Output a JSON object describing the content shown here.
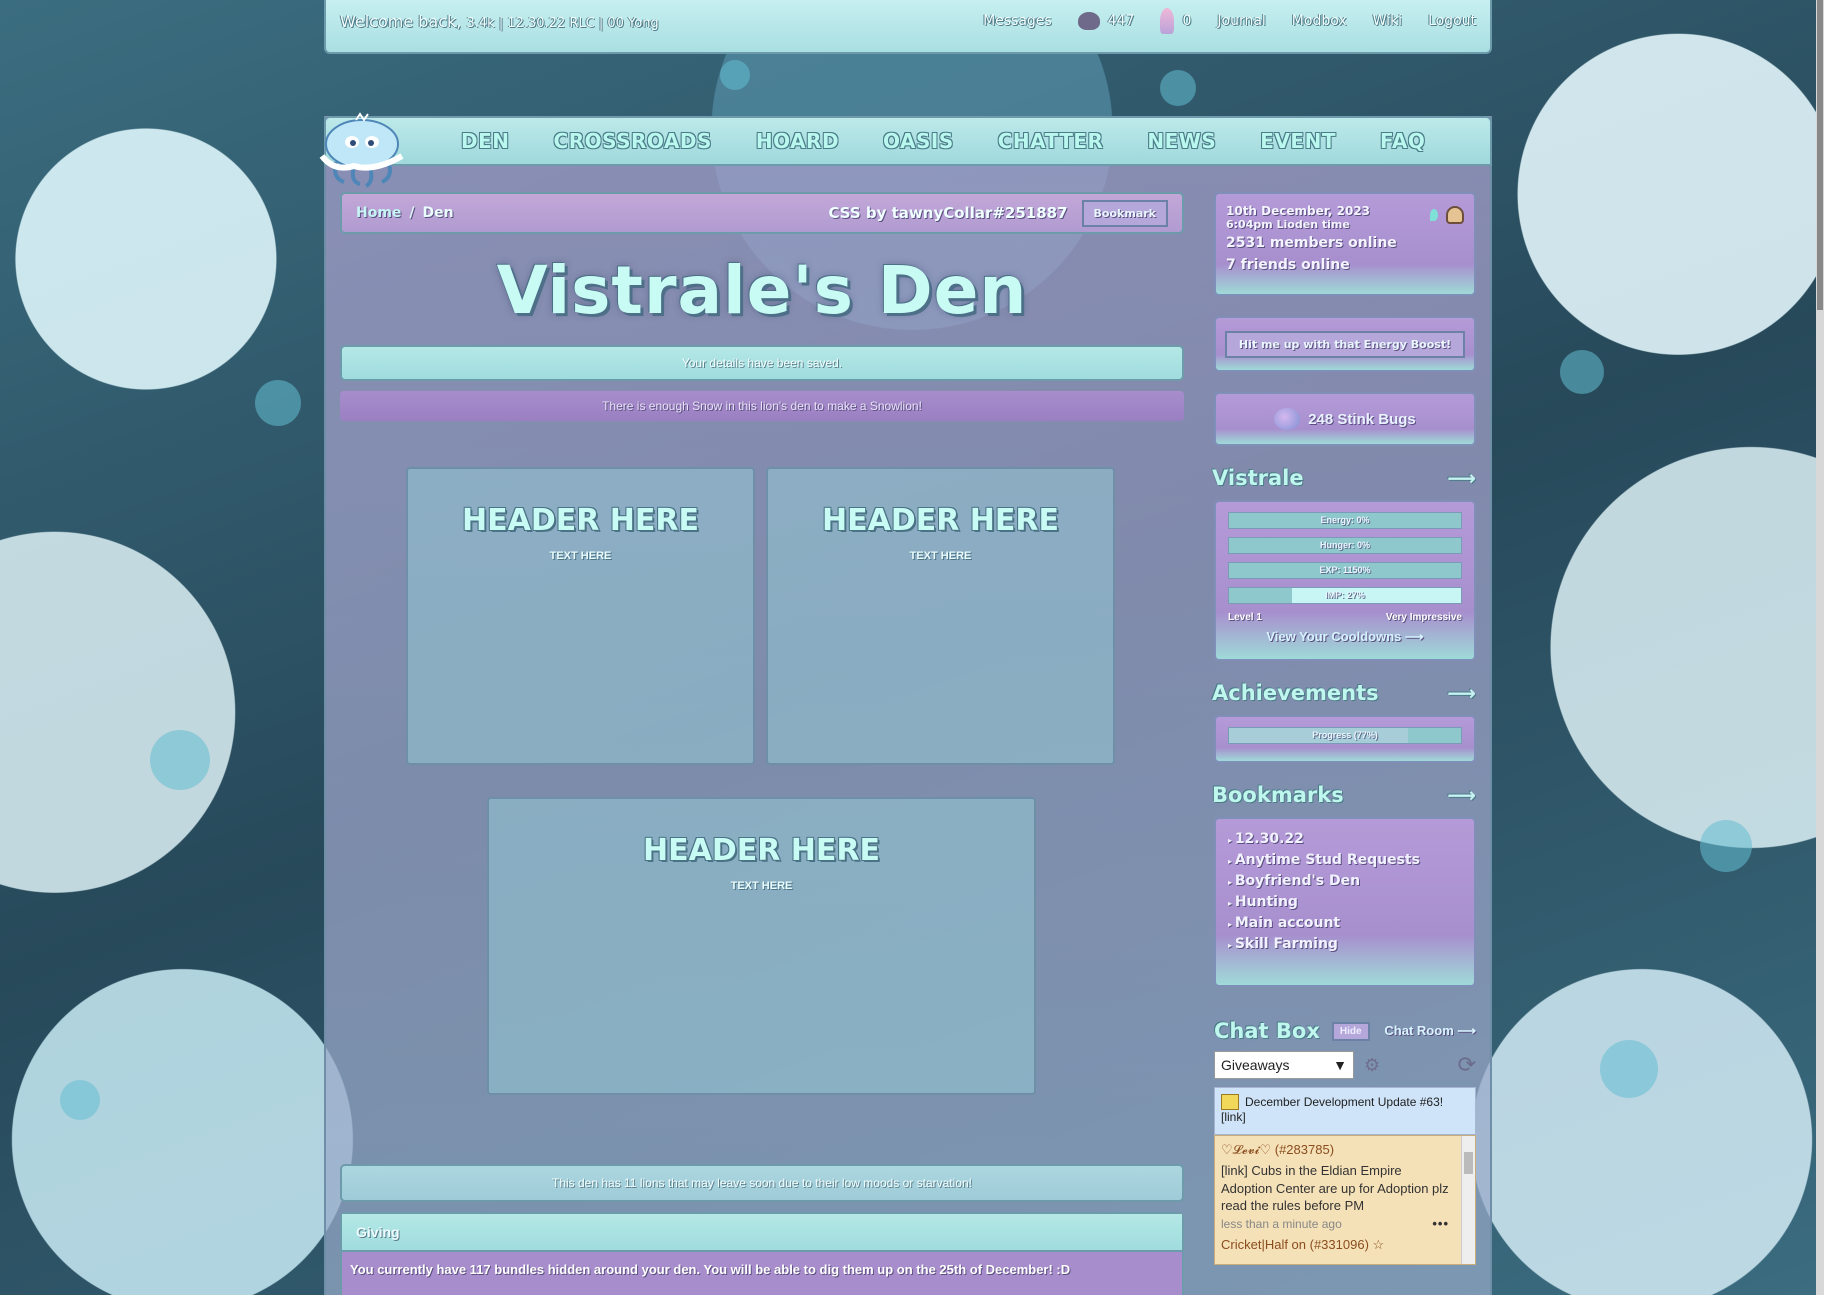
{
  "topbar": {
    "welcome": "Welcome back,",
    "welcome_sub": "3.4k | 12.30.22 RLC | 00 Yong",
    "links": [
      "Messages",
      "Journal",
      "Modbox",
      "Wiki",
      "Logout"
    ],
    "currency1": "447",
    "currency2": "0"
  },
  "nav": [
    "DEN",
    "CROSSROADS",
    "HOARD",
    "OASIS",
    "CHATTER",
    "NEWS",
    "EVENT",
    "FAQ"
  ],
  "breadcrumb": {
    "home": "Home",
    "sep": "/",
    "current": "Den",
    "credit": "CSS by tawnyCollar#251887",
    "bookmark": "Bookmark"
  },
  "title": "Vistrale's Den",
  "notices": {
    "saved": "Your details have been saved.",
    "snow": "There is enough Snow in this lion's den to make a Snowlion!",
    "leave": "This den has 11 lions that may leave soon due to their low moods or starvation!"
  },
  "boxes": [
    {
      "header": "HEADER HERE",
      "text": "TEXT HERE"
    },
    {
      "header": "HEADER HERE",
      "text": "TEXT HERE"
    },
    {
      "header": "HEADER HERE",
      "text": "TEXT HERE"
    }
  ],
  "giving": {
    "title": "Giving",
    "text": "You currently have 117 bundles hidden around your den. You will be able to dig them up on the 25th of December! :D"
  },
  "sidebar": {
    "date": "10th December, 2023",
    "time": "6:04pm Lioden time",
    "members": "2531 members online",
    "friends": "7 friends online",
    "energy_button": "Hit me up with that Energy Boost!",
    "bugs": "248 Stink Bugs",
    "lion_name": "Vistrale",
    "arrow": "⟶",
    "bars": [
      {
        "label": "Energy: 0%",
        "value": 0
      },
      {
        "label": "Hunger: 0%",
        "value": 0
      },
      {
        "label": "EXP: 1150%",
        "value": 0
      },
      {
        "label": "IMP: 27%",
        "value": 27
      }
    ],
    "level": "Level 1",
    "impression": "Very Impressive",
    "cooldowns": "View Your Cooldowns ⟶",
    "achievements_title": "Achievements",
    "achievements_bar": {
      "label": "Progress (77%)",
      "value": 77
    },
    "bookmarks_title": "Bookmarks",
    "bookmarks": [
      "12.30.22",
      "Anytime Stud Requests",
      "Boyfriend's Den",
      "Hunting",
      "Main account",
      "Skill Farming"
    ],
    "chat_title": "Chat Box",
    "hide": "Hide",
    "chat_room": "Chat Room ⟶",
    "chat_select": "Giveaways",
    "news": "December Development Update #63!",
    "news_link": "[link]",
    "msg1_name": "♡𝓛𝓮𝓿𝓲♡ (#283785)",
    "msg1_text": "[link] Cubs in the Eldian Empire Adoption Center are up for Adoption plz read the rules before PM",
    "msg1_time": "less than a minute ago",
    "msg2_name": "Cricket|Half on (#331096) ☆"
  },
  "colors": {
    "accent_teal": "#a9dfe2",
    "accent_purple": "#a88dcc",
    "text_mint": "#c9fbf5"
  }
}
